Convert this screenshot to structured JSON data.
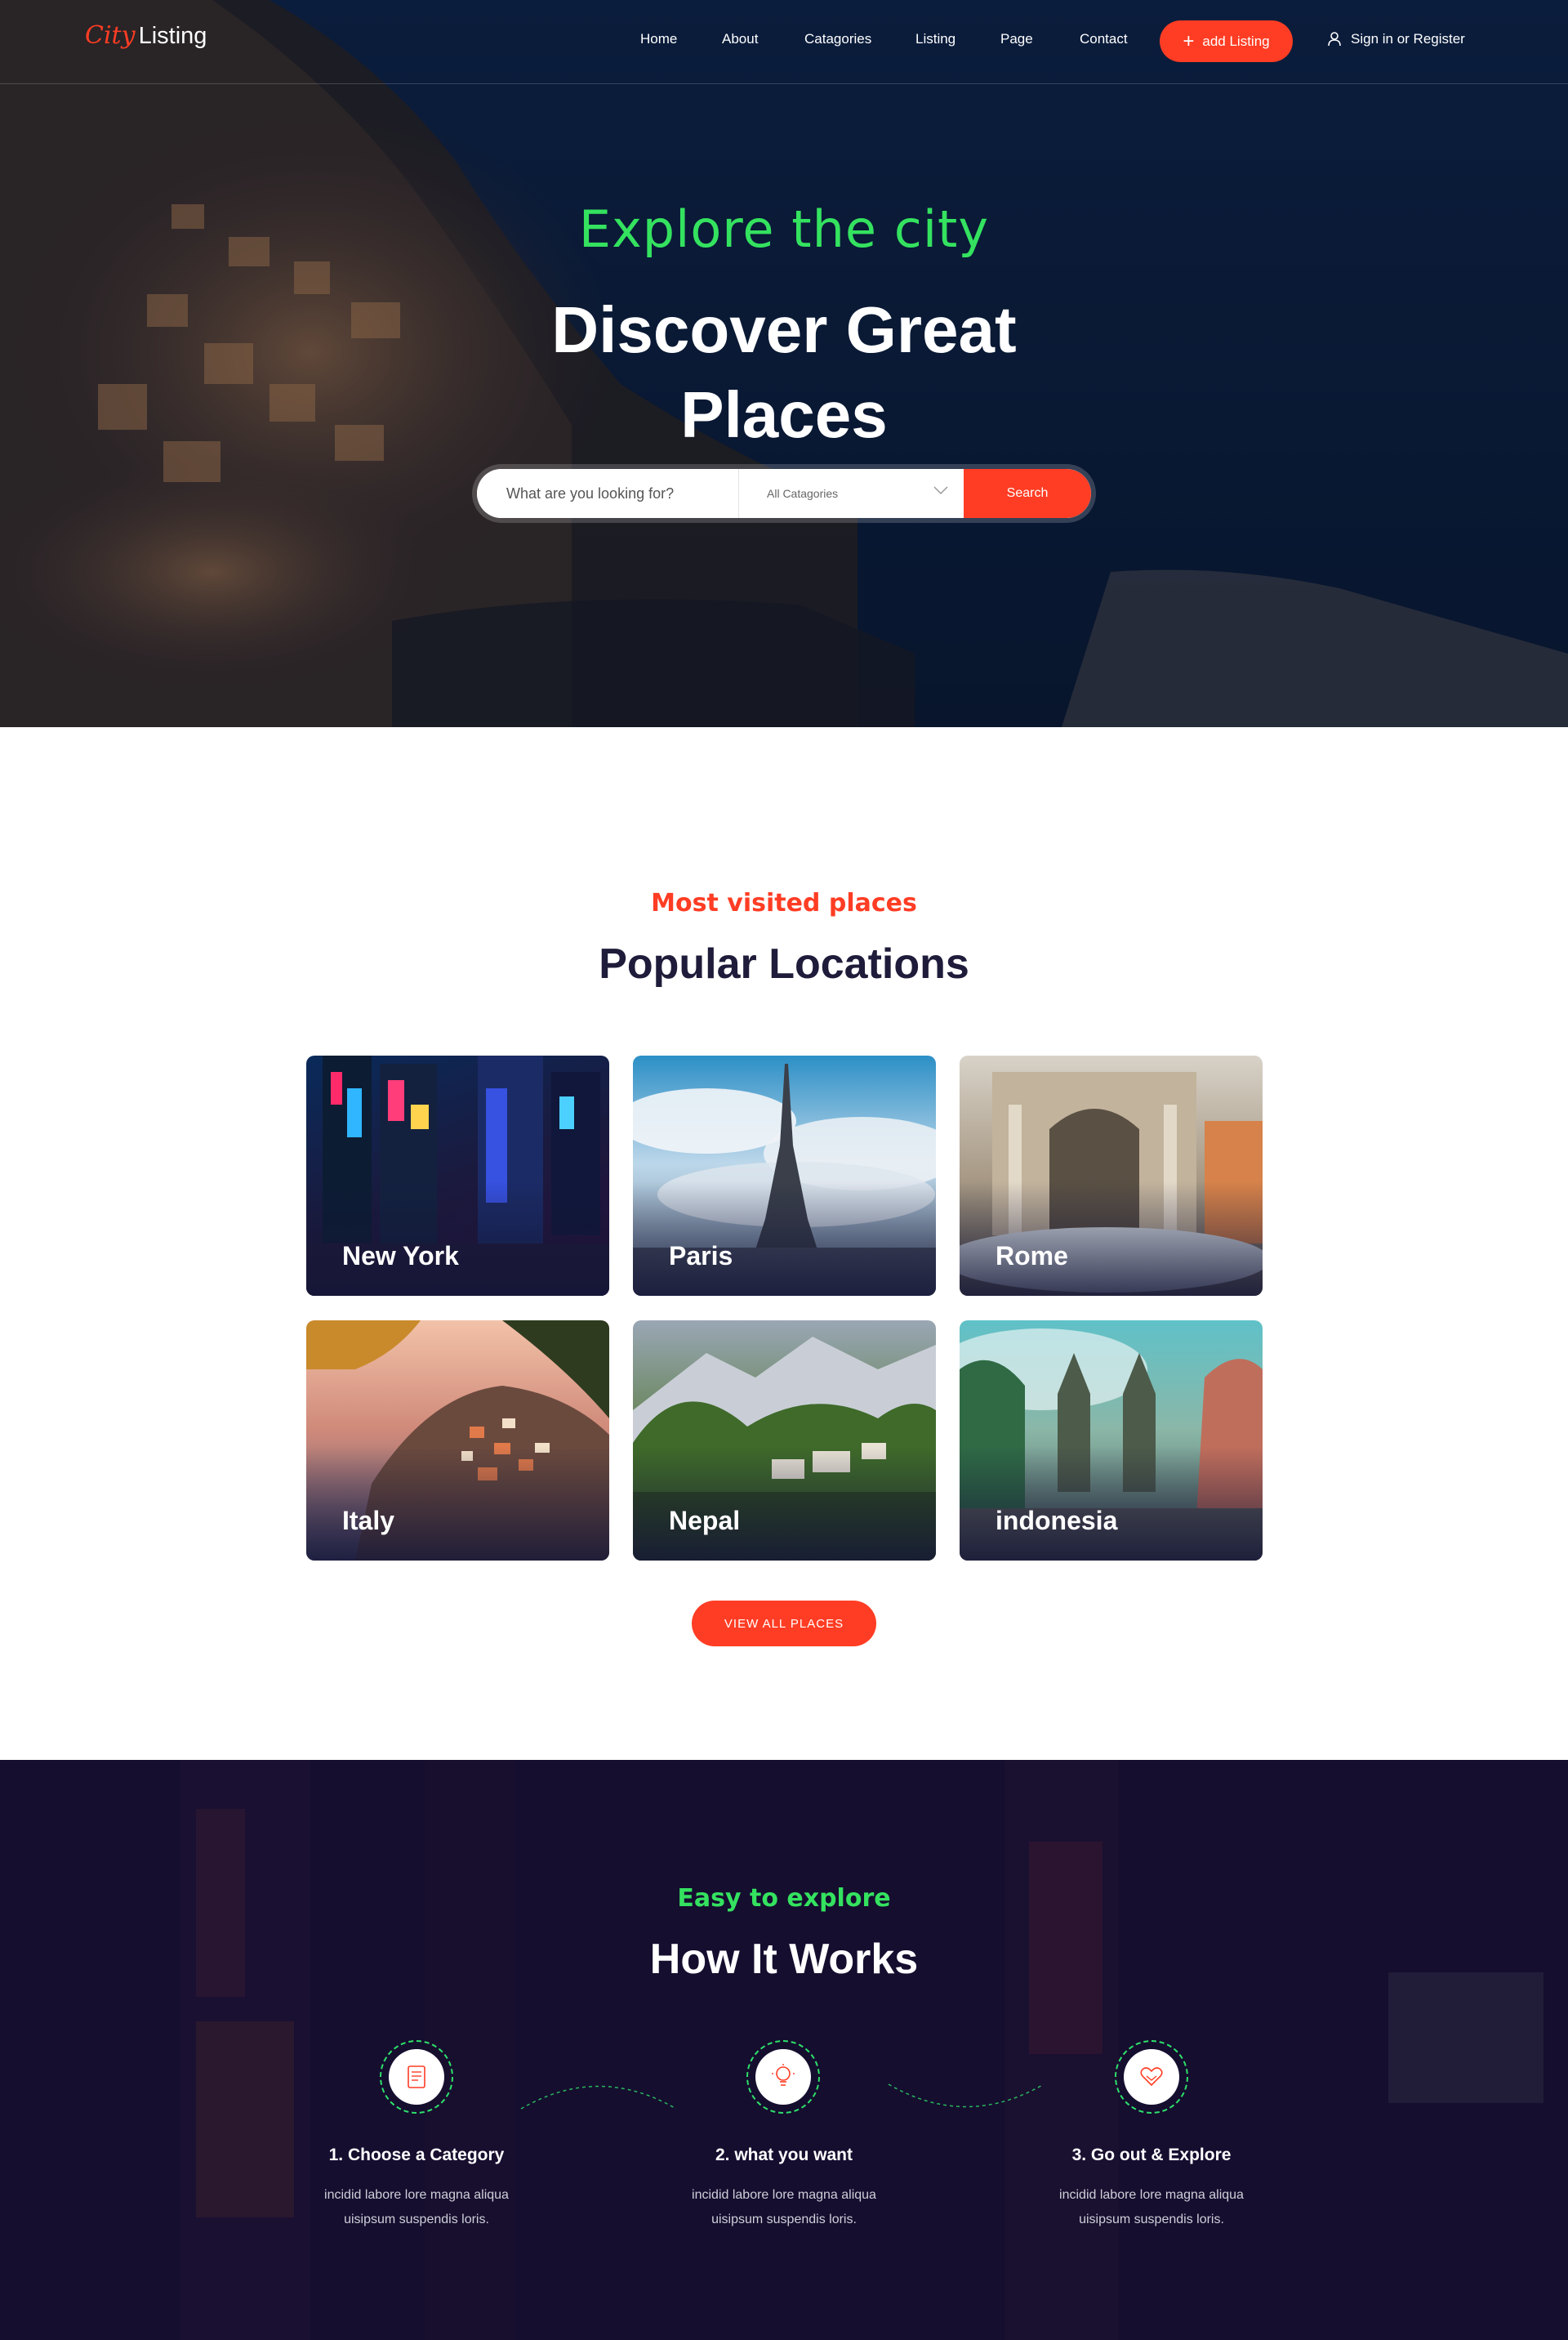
{
  "header": {
    "logo_city": "City",
    "logo_listing": "Listing",
    "nav": [
      "Home",
      "About",
      "Catagories",
      "Listing",
      "Page",
      "Contact"
    ],
    "add_listing": "add Listing",
    "sign_in": "Sign in or Register"
  },
  "hero": {
    "script": "Explore the city",
    "title": "Discover Great Places",
    "search_placeholder": "What are you looking for?",
    "category_select": "All Catagories",
    "search_button": "Search"
  },
  "popular": {
    "script": "Most visited places",
    "title": "Popular Locations",
    "cards": [
      {
        "label": "New York"
      },
      {
        "label": "Paris"
      },
      {
        "label": "Rome"
      },
      {
        "label": "Italy"
      },
      {
        "label": "Nepal"
      },
      {
        "label": "indonesia"
      }
    ],
    "view_all": "VIEW ALL PLACES"
  },
  "how": {
    "script": "Easy to explore",
    "title": "How It Works",
    "steps": [
      {
        "title": "1. Choose a Category",
        "line1": "incidid labore lore magna aliqua",
        "line2": "uisipsum suspendis loris."
      },
      {
        "title": "2. what you want",
        "line1": "incidid labore lore magna aliqua",
        "line2": "uisipsum suspendis loris."
      },
      {
        "title": "3. Go out & Explore",
        "line1": "incidid labore lore magna aliqua",
        "line2": "uisipsum suspendis loris."
      }
    ]
  },
  "colors": {
    "accent_red": "#ff3d24",
    "accent_green": "#34e25f",
    "dark_navy": "#1e1c3a"
  }
}
